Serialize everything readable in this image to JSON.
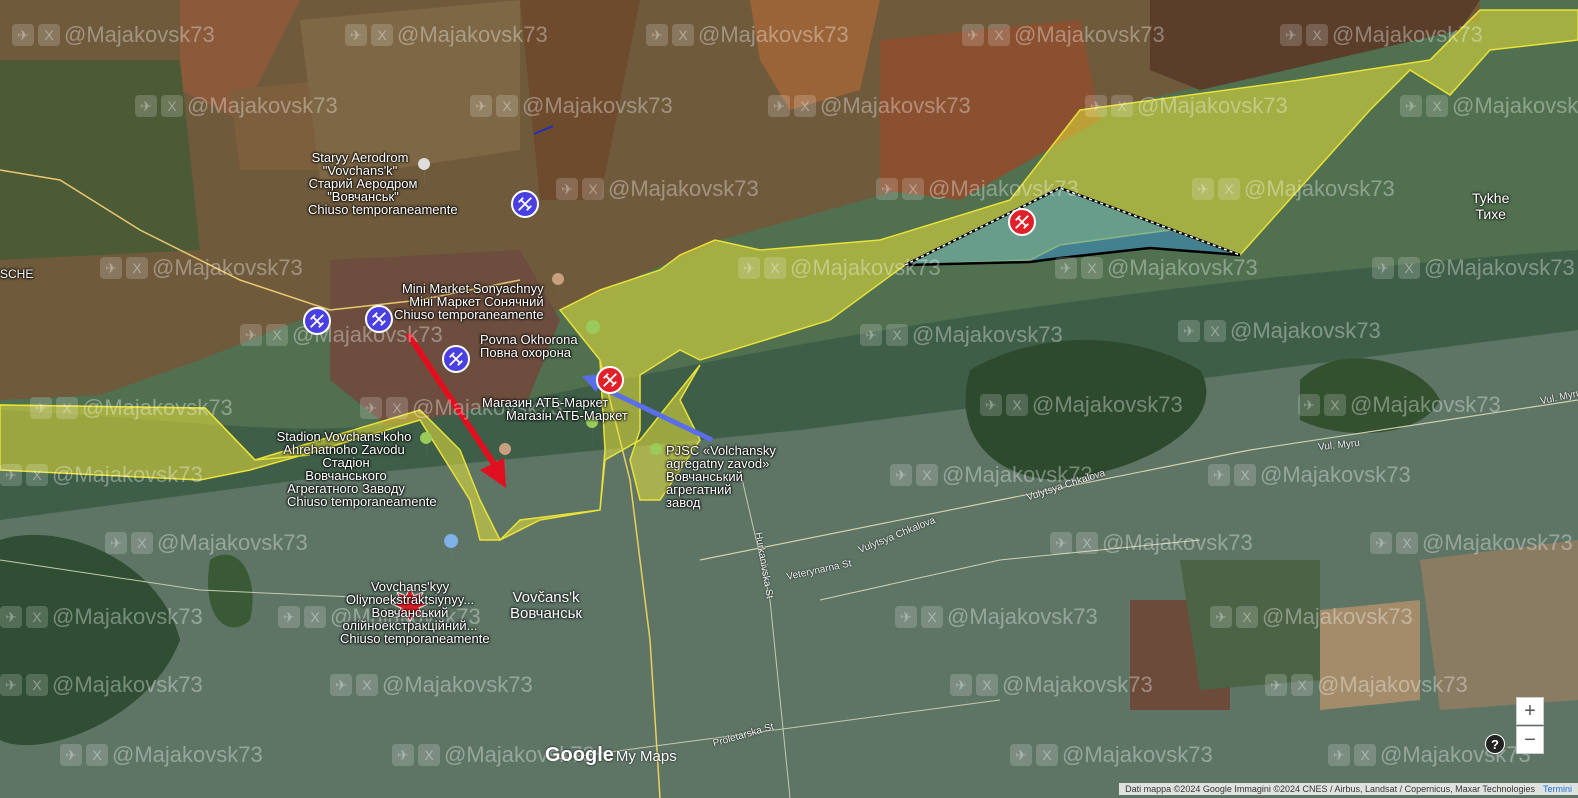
{
  "watermark": "@Majakovsk73",
  "places": {
    "aerodrom": {
      "name": "Staryy Aerodrom \"Vovchans'k\"",
      "local": "Старий Аеродром \"Вовчанськ\"",
      "status": "Chiuso temporaneamente"
    },
    "minimarket": {
      "name": "Mini Market Sonyachnyy",
      "local": "Міні Маркет Сонячний",
      "status": "Chiuso temporaneamente"
    },
    "povna": {
      "name": "Povna Okhorona",
      "local": "Повна охорона"
    },
    "atb": {
      "name": "Магазин АТБ-Маркет",
      "local": "Магазін АТБ-Маркет"
    },
    "stadion": {
      "name": "Stadion Vovchans'koho Ahrehatnoho Zavodu",
      "local": "Стадіон Вовчанського Агрегатного Заводу",
      "status": "Chiuso temporaneamente"
    },
    "pjsc": {
      "name": "PJSC «Volchansky agregatny zavod»",
      "local": "Вовчанський агрегатний завод"
    },
    "oliynoek": {
      "name": "Vovchans'kyy Oliynoekstraktsiynyy...",
      "local": "Вовчанський олійноекстракційний...",
      "status": "Chiuso temporaneamente"
    },
    "city": {
      "name": "Vovčans'k",
      "local": "Вовчанськ"
    },
    "tykhe": {
      "name": "Tykhe",
      "local": "Тихе"
    },
    "edge": {
      "name": "SCHE"
    }
  },
  "roads": [
    "Vul. Myru",
    "Vul. Myru",
    "Vulytsya Chkalova",
    "Vulytsya Chkalova",
    "Veterynarna St",
    "Hurkanivska St",
    "Proletarska St"
  ],
  "branding": {
    "google": "Google",
    "mymaps": "My Maps"
  },
  "controls": {
    "zoom_in": "+",
    "zoom_out": "−",
    "help": "?"
  },
  "attribution": {
    "text": "Dati mappa ©2024 Google Immagini ©2024 CNES / Airbus, Landsat / Copernicus, Maxar Technologies",
    "terms": "Termini"
  },
  "colors": {
    "controlled_zone": "#e8e23a",
    "contested_zone": "#3a8fc7",
    "friendly_marker": "#4a3fe0",
    "enemy_marker": "#e0202a",
    "attack_arrow": "#e01020",
    "blue_arrow": "#5a6ee8"
  }
}
